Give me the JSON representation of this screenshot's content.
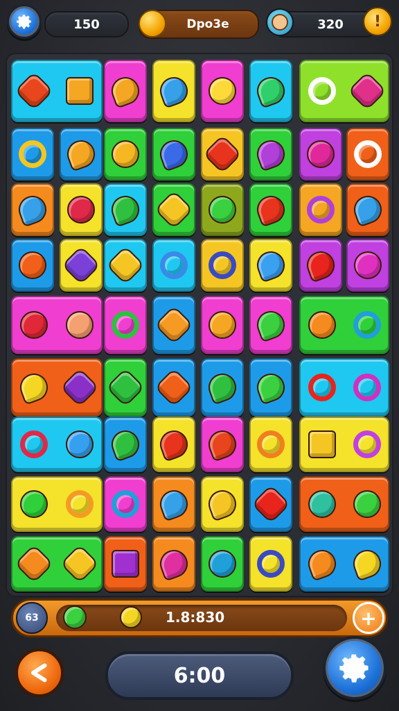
{
  "top_bar": {
    "score_value": "150",
    "title_label": "Dpo3e",
    "coins_value": "320",
    "alert_glyph": "!"
  },
  "board": {
    "rows": [
      [
        {
          "color": "#1fc8f0",
          "w": 2,
          "icons": [
            {
              "shape": "star",
              "color": "#e8461d"
            },
            {
              "shape": "sq",
              "color": "#f5a623"
            }
          ]
        },
        {
          "color": "#f03ed0",
          "w": 1,
          "icons": [
            {
              "shape": "drop",
              "color": "#f5a623"
            }
          ]
        },
        {
          "color": "#f5e22a",
          "w": 1,
          "icons": [
            {
              "shape": "drop",
              "color": "#36a0e8"
            }
          ]
        },
        {
          "color": "#f03ed0",
          "w": 1,
          "icons": [
            {
              "shape": "circle",
              "color": "#ffd93a"
            }
          ]
        },
        {
          "color": "#1fc8f0",
          "w": 1,
          "icons": [
            {
              "shape": "drop",
              "color": "#2fd06a"
            }
          ]
        },
        {
          "color": "#8ee02a",
          "w": 2,
          "icons": [
            {
              "shape": "ring",
              "color": "#ffffff"
            },
            {
              "shape": "star",
              "color": "#e0308a"
            }
          ]
        }
      ],
      [
        {
          "color": "#1e9be8",
          "w": 1,
          "icons": [
            {
              "shape": "ring",
              "color": "#f5c623"
            }
          ]
        },
        {
          "color": "#1e9be8",
          "w": 1,
          "icons": [
            {
              "shape": "drop",
              "color": "#f5a623"
            }
          ]
        },
        {
          "color": "#2fd03a",
          "w": 1,
          "icons": [
            {
              "shape": "circle",
              "color": "#f5b823"
            }
          ]
        },
        {
          "color": "#2fd03a",
          "w": 1,
          "icons": [
            {
              "shape": "drop",
              "color": "#3a6ae8"
            }
          ]
        },
        {
          "color": "#f5c623",
          "w": 1,
          "icons": [
            {
              "shape": "star",
              "color": "#e8341d"
            }
          ]
        },
        {
          "color": "#2fd03a",
          "w": 1,
          "icons": [
            {
              "shape": "drop",
              "color": "#b040d8"
            }
          ]
        },
        {
          "color": "#c040e0",
          "w": 1,
          "icons": [
            {
              "shape": "circle",
              "color": "#e0289a"
            }
          ]
        },
        {
          "color": "#f06018",
          "w": 1,
          "icons": [
            {
              "shape": "ring",
              "color": "#ffffff"
            }
          ]
        }
      ],
      [
        {
          "color": "#f58a1e",
          "w": 1,
          "icons": [
            {
              "shape": "drop",
              "color": "#36a0e8"
            }
          ]
        },
        {
          "color": "#f5e22a",
          "w": 1,
          "icons": [
            {
              "shape": "circle",
              "color": "#e02848"
            }
          ]
        },
        {
          "color": "#1fc8f0",
          "w": 1,
          "icons": [
            {
              "shape": "drop",
              "color": "#2fc040"
            }
          ]
        },
        {
          "color": "#2fd03a",
          "w": 1,
          "icons": [
            {
              "shape": "star",
              "color": "#f5c623"
            }
          ]
        },
        {
          "color": "#8ea81e",
          "w": 1,
          "icons": [
            {
              "shape": "circle",
              "color": "#3ad040"
            }
          ]
        },
        {
          "color": "#2fd03a",
          "w": 1,
          "icons": [
            {
              "shape": "drop",
              "color": "#e8341d"
            }
          ]
        },
        {
          "color": "#f5a623",
          "w": 1,
          "icons": [
            {
              "shape": "ring",
              "color": "#b040d8"
            }
          ]
        },
        {
          "color": "#f06018",
          "w": 1,
          "icons": [
            {
              "shape": "drop",
              "color": "#36a0e8"
            }
          ]
        }
      ],
      [
        {
          "color": "#1e9be8",
          "w": 1,
          "icons": [
            {
              "shape": "circle",
              "color": "#f06018"
            }
          ]
        },
        {
          "color": "#f5e22a",
          "w": 1,
          "icons": [
            {
              "shape": "star",
              "color": "#7a40d8"
            }
          ]
        },
        {
          "color": "#1fc8f0",
          "w": 1,
          "icons": [
            {
              "shape": "star",
              "color": "#f5c623"
            }
          ]
        },
        {
          "color": "#1fc8f0",
          "w": 1,
          "icons": [
            {
              "shape": "ring",
              "color": "#3a8ae8"
            }
          ]
        },
        {
          "color": "#f5c623",
          "w": 1,
          "icons": [
            {
              "shape": "ring",
              "color": "#3a4ac0"
            }
          ]
        },
        {
          "color": "#f5e22a",
          "w": 1,
          "icons": [
            {
              "shape": "drop",
              "color": "#3aa0f0"
            }
          ]
        },
        {
          "color": "#c040e0",
          "w": 1,
          "icons": [
            {
              "shape": "drop",
              "color": "#e8241d"
            }
          ]
        },
        {
          "color": "#c040e0",
          "w": 1,
          "icons": [
            {
              "shape": "circle",
              "color": "#e030c0"
            }
          ]
        }
      ],
      [
        {
          "color": "#f03ed0",
          "w": 2,
          "icons": [
            {
              "shape": "circle",
              "color": "#e02838"
            },
            {
              "shape": "circle",
              "color": "#f5a070"
            }
          ]
        },
        {
          "color": "#f03ed0",
          "w": 1,
          "icons": [
            {
              "shape": "ring",
              "color": "#2fc040"
            }
          ]
        },
        {
          "color": "#1e9be8",
          "w": 1,
          "icons": [
            {
              "shape": "star",
              "color": "#f59a23"
            }
          ]
        },
        {
          "color": "#f03ed0",
          "w": 1,
          "icons": [
            {
              "shape": "circle",
              "color": "#f5a623"
            }
          ]
        },
        {
          "color": "#f03ed0",
          "w": 1,
          "icons": [
            {
              "shape": "drop",
              "color": "#3ad040"
            }
          ]
        },
        {
          "color": "#2fd03a",
          "w": 2,
          "icons": [
            {
              "shape": "circle",
              "color": "#f58a1e"
            },
            {
              "shape": "ring",
              "color": "#1fa0d8"
            }
          ]
        }
      ],
      [
        {
          "color": "#f06018",
          "w": 2,
          "icons": [
            {
              "shape": "drop",
              "color": "#f5d623"
            },
            {
              "shape": "star",
              "color": "#8a30c8"
            }
          ]
        },
        {
          "color": "#2fd03a",
          "w": 1,
          "icons": [
            {
              "shape": "star",
              "color": "#2fc040"
            }
          ]
        },
        {
          "color": "#1e9be8",
          "w": 1,
          "icons": [
            {
              "shape": "star",
              "color": "#f06018"
            }
          ]
        },
        {
          "color": "#1e9be8",
          "w": 1,
          "icons": [
            {
              "shape": "drop",
              "color": "#2fc040"
            }
          ]
        },
        {
          "color": "#1e9be8",
          "w": 1,
          "icons": [
            {
              "shape": "drop",
              "color": "#3ad040"
            }
          ]
        },
        {
          "color": "#1fc8f0",
          "w": 2,
          "icons": [
            {
              "shape": "ring",
              "color": "#e8241d"
            },
            {
              "shape": "ring",
              "color": "#d030c0"
            }
          ]
        }
      ],
      [
        {
          "color": "#1fc8f0",
          "w": 2,
          "icons": [
            {
              "shape": "ring",
              "color": "#e02848"
            },
            {
              "shape": "circle",
              "color": "#36a0f0"
            }
          ]
        },
        {
          "color": "#1e9be8",
          "w": 1,
          "icons": [
            {
              "shape": "drop",
              "color": "#2fc040"
            }
          ]
        },
        {
          "color": "#f5e22a",
          "w": 1,
          "icons": [
            {
              "shape": "drop",
              "color": "#e8341d"
            }
          ]
        },
        {
          "color": "#f03ed0",
          "w": 1,
          "icons": [
            {
              "shape": "drop",
              "color": "#e8441d"
            }
          ]
        },
        {
          "color": "#f5e22a",
          "w": 1,
          "icons": [
            {
              "shape": "ring",
              "color": "#f0801e"
            }
          ]
        },
        {
          "color": "#f5e22a",
          "w": 2,
          "icons": [
            {
              "shape": "sq",
              "color": "#f5c623"
            },
            {
              "shape": "ring",
              "color": "#c040e0"
            }
          ]
        }
      ],
      [
        {
          "color": "#f5e22a",
          "w": 2,
          "icons": [
            {
              "shape": "circle",
              "color": "#2fd03a"
            },
            {
              "shape": "ring",
              "color": "#f59a23"
            }
          ]
        },
        {
          "color": "#f03ed0",
          "w": 1,
          "icons": [
            {
              "shape": "ring",
              "color": "#1fa0d8"
            }
          ]
        },
        {
          "color": "#f58a1e",
          "w": 1,
          "icons": [
            {
              "shape": "drop",
              "color": "#36a0e8"
            }
          ]
        },
        {
          "color": "#f5e22a",
          "w": 1,
          "icons": [
            {
              "shape": "drop",
              "color": "#f5c623"
            }
          ]
        },
        {
          "color": "#1e9be8",
          "w": 1,
          "icons": [
            {
              "shape": "star",
              "color": "#e8241d"
            }
          ]
        },
        {
          "color": "#f06018",
          "w": 2,
          "icons": [
            {
              "shape": "circle",
              "color": "#2fc0a0"
            },
            {
              "shape": "circle",
              "color": "#3ad040"
            }
          ]
        }
      ],
      [
        {
          "color": "#2fd03a",
          "w": 2,
          "icons": [
            {
              "shape": "star",
              "color": "#f58a1e"
            },
            {
              "shape": "star",
              "color": "#f5c623"
            }
          ]
        },
        {
          "color": "#f06018",
          "w": 1,
          "icons": [
            {
              "shape": "sq",
              "color": "#a030d0"
            }
          ]
        },
        {
          "color": "#f58a1e",
          "w": 1,
          "icons": [
            {
              "shape": "drop",
              "color": "#e030a0"
            }
          ]
        },
        {
          "color": "#2fd03a",
          "w": 1,
          "icons": [
            {
              "shape": "circle",
              "color": "#1fa0d8"
            }
          ]
        },
        {
          "color": "#f5e22a",
          "w": 1,
          "icons": [
            {
              "shape": "ring",
              "color": "#3a4ac0"
            }
          ]
        },
        {
          "color": "#1e9be8",
          "w": 2,
          "icons": [
            {
              "shape": "drop",
              "color": "#f58a1e"
            },
            {
              "shape": "drop",
              "color": "#f5d623"
            }
          ]
        }
      ]
    ]
  },
  "bottom_bar": {
    "level_badge": "63",
    "score_text": "1.8:830",
    "add_glyph": "+"
  },
  "timer": {
    "value": "6:00"
  }
}
